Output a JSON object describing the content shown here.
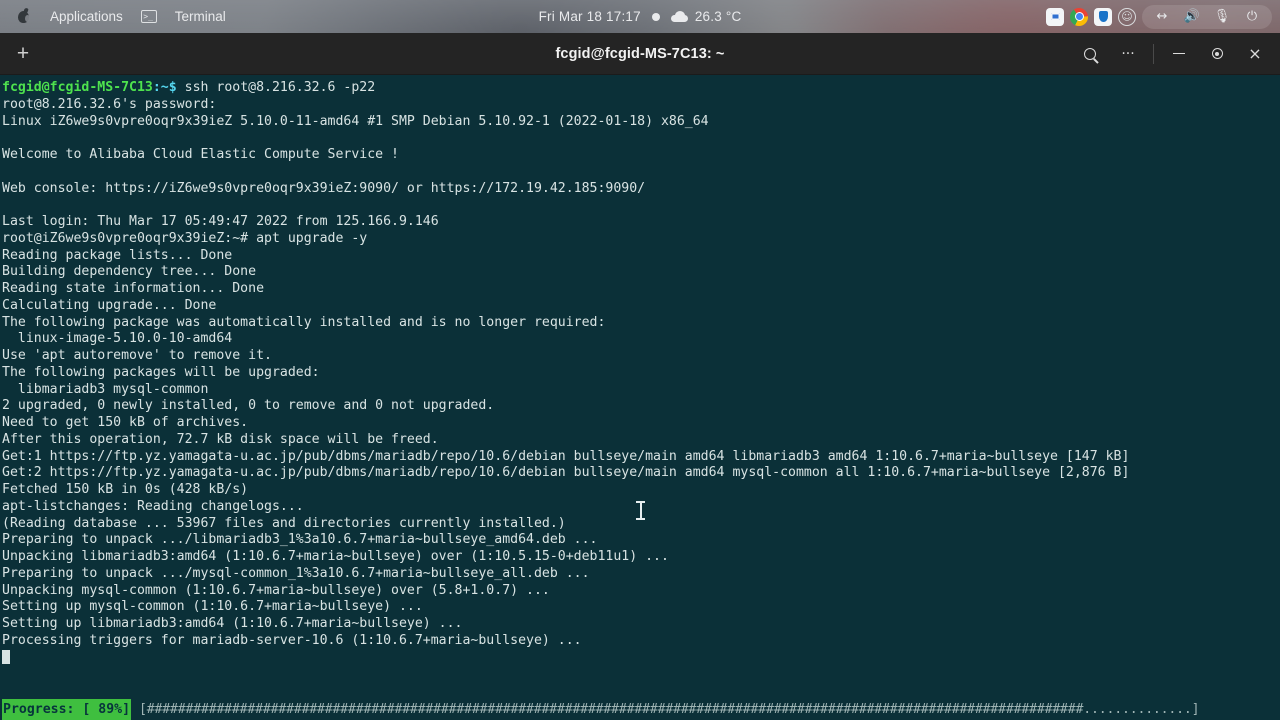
{
  "topbar": {
    "apple_icon": "apple-icon",
    "applications_label": "Applications",
    "terminal_icon": "terminal-icon",
    "terminal_label": "Terminal",
    "clock": "Fri Mar 18  17:17",
    "status_dot": "recording-dot-icon",
    "weather_icon": "cloud-icon",
    "temperature": "26.3 °C",
    "tray": [
      {
        "name": "screenshot-icon",
        "glyph": ""
      },
      {
        "name": "chrome-icon",
        "glyph": ""
      },
      {
        "name": "shield-icon",
        "glyph": ""
      },
      {
        "name": "accessibility-icon",
        "glyph": ""
      },
      {
        "name": "network-icon",
        "glyph": "‹›"
      },
      {
        "name": "volume-icon",
        "glyph": "🔊"
      },
      {
        "name": "microphone-icon",
        "glyph": "🎤"
      },
      {
        "name": "power-icon",
        "glyph": "⏻"
      }
    ]
  },
  "window": {
    "new_tab_label": "+",
    "title": "fcgid@fcgid-MS-7C13: ~",
    "buttons": {
      "search": "search-icon",
      "menu": "···",
      "minimize": "minimize-icon",
      "maximize": "maximize-icon",
      "close": "×"
    }
  },
  "terminal": {
    "prompt1": {
      "userhost": "fcgid@fcgid-MS-7C13",
      "path": ":~$",
      "command": " ssh root@8.216.32.6 -p22"
    },
    "prompt2": {
      "userhost": "root@iZ6we9s0vpre0oqr9x39ieZ",
      "path": ":~#",
      "command": " apt upgrade -y"
    },
    "lines": [
      "root@8.216.32.6's password:",
      "Linux iZ6we9s0vpre0oqr9x39ieZ 5.10.0-11-amd64 #1 SMP Debian 5.10.92-1 (2022-01-18) x86_64",
      "",
      "Welcome to Alibaba Cloud Elastic Compute Service !",
      "",
      "Web console: https://iZ6we9s0vpre0oqr9x39ieZ:9090/ or https://172.19.42.185:9090/",
      "",
      "Last login: Thu Mar 17 05:49:47 2022 from 125.166.9.146"
    ],
    "output": [
      "Reading package lists... Done",
      "Building dependency tree... Done",
      "Reading state information... Done",
      "Calculating upgrade... Done",
      "The following package was automatically installed and is no longer required:",
      "  linux-image-5.10.0-10-amd64",
      "Use 'apt autoremove' to remove it.",
      "The following packages will be upgraded:",
      "  libmariadb3 mysql-common",
      "2 upgraded, 0 newly installed, 0 to remove and 0 not upgraded.",
      "Need to get 150 kB of archives.",
      "After this operation, 72.7 kB disk space will be freed.",
      "Get:1 https://ftp.yz.yamagata-u.ac.jp/pub/dbms/mariadb/repo/10.6/debian bullseye/main amd64 libmariadb3 amd64 1:10.6.7+maria~bullseye [147 kB]",
      "Get:2 https://ftp.yz.yamagata-u.ac.jp/pub/dbms/mariadb/repo/10.6/debian bullseye/main amd64 mysql-common all 1:10.6.7+maria~bullseye [2,876 B]",
      "Fetched 150 kB in 0s (428 kB/s)",
      "apt-listchanges: Reading changelogs...",
      "(Reading database ... 53967 files and directories currently installed.)",
      "Preparing to unpack .../libmariadb3_1%3a10.6.7+maria~bullseye_amd64.deb ...",
      "Unpacking libmariadb3:amd64 (1:10.6.7+maria~bullseye) over (1:10.5.15-0+deb11u1) ...",
      "Preparing to unpack .../mysql-common_1%3a10.6.7+maria~bullseye_all.deb ...",
      "Unpacking mysql-common (1:10.6.7+maria~bullseye) over (5.8+1.0.7) ...",
      "Setting up mysql-common (1:10.6.7+maria~bullseye) ...",
      "Setting up libmariadb3:amd64 (1:10.6.7+maria~bullseye) ...",
      "Processing triggers for mariadb-server-10.6 (1:10.6.7+maria~bullseye) ..."
    ]
  },
  "status": {
    "progress_label": "Progress: [ 89%]",
    "progress_percent": 89,
    "progress_bar": "[#########################################################################################################################..............]"
  },
  "colors": {
    "terminal_bg": "#0b3038",
    "terminal_fg": "#d8e3e3",
    "prompt_green": "#4ee24e",
    "prompt_cyan": "#56d7f0",
    "progress_green": "#3fbf3f",
    "titlebar_bg": "#242424"
  }
}
